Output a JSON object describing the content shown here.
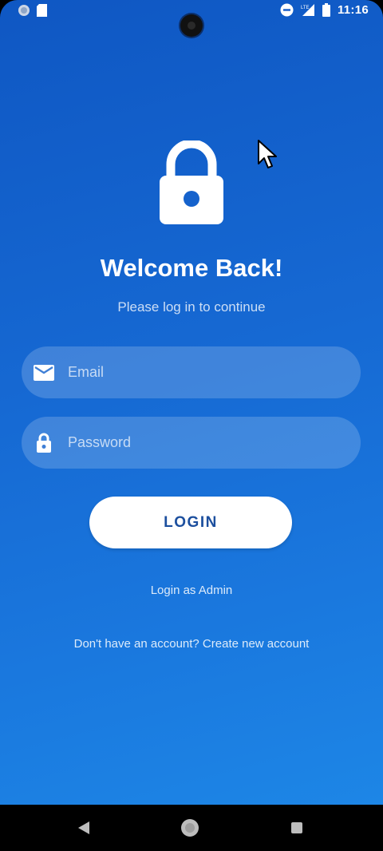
{
  "status_bar": {
    "time": "11:16",
    "network_label": "LTE"
  },
  "icons": {
    "hero": "lock-icon",
    "email_field": "mail-icon",
    "password_field": "lock-icon"
  },
  "login": {
    "title": "Welcome Back!",
    "subtitle": "Please log in to continue",
    "email_placeholder": "Email",
    "password_placeholder": "Password",
    "login_button": "LOGIN",
    "admin_link": "Login as Admin",
    "signup_link": "Don't have an account? Create new account"
  },
  "colors": {
    "gradient_top": "#0f57c3",
    "gradient_bottom": "#1d86e6",
    "button_text": "#1c4f9e"
  }
}
